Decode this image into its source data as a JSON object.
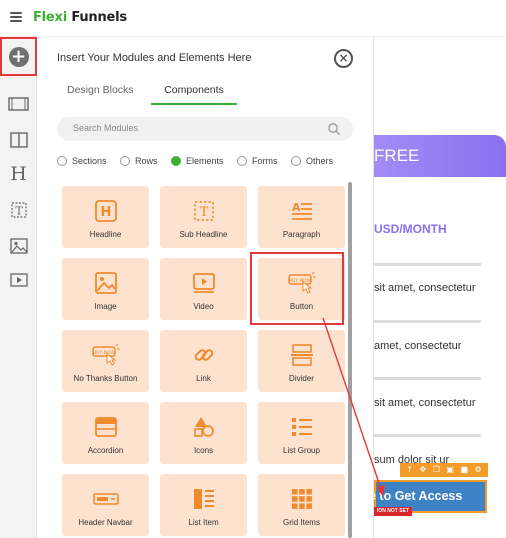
{
  "app": {
    "logo_part1": "Flexi",
    "logo_part2": "Funnels"
  },
  "rail": {
    "items": [
      {
        "name": "add-icon"
      },
      {
        "name": "section-icon"
      },
      {
        "name": "columns-icon"
      },
      {
        "name": "heading-icon",
        "glyph": "H"
      },
      {
        "name": "text-icon"
      },
      {
        "name": "image-icon"
      },
      {
        "name": "video-icon"
      }
    ]
  },
  "panel": {
    "title": "Insert Your Modules and Elements Here",
    "tabs": [
      {
        "label": "Design Blocks",
        "active": false
      },
      {
        "label": "Components",
        "active": true
      }
    ],
    "search_placeholder": "Search Modules",
    "filters": [
      {
        "label": "Sections",
        "selected": false
      },
      {
        "label": "Rows",
        "selected": false
      },
      {
        "label": "Elements",
        "selected": true
      },
      {
        "label": "Forms",
        "selected": false
      },
      {
        "label": "Others",
        "selected": false
      }
    ],
    "tiles": [
      {
        "label": "Headline",
        "icon": "headline-icon"
      },
      {
        "label": "Sub Headline",
        "icon": "sub-headline-icon"
      },
      {
        "label": "Paragraph",
        "icon": "paragraph-icon"
      },
      {
        "label": "Image",
        "icon": "image-icon"
      },
      {
        "label": "Video",
        "icon": "video-icon"
      },
      {
        "label": "Button",
        "icon": "button-icon"
      },
      {
        "label": "No Thanks Button",
        "icon": "no-thanks-button-icon"
      },
      {
        "label": "Link",
        "icon": "link-icon"
      },
      {
        "label": "Divider",
        "icon": "divider-icon"
      },
      {
        "label": "Accordion",
        "icon": "accordion-icon"
      },
      {
        "label": "Icons",
        "icon": "icons-icon"
      },
      {
        "label": "List Group",
        "icon": "list-group-icon"
      },
      {
        "label": "Header Navbar",
        "icon": "header-navbar-icon"
      },
      {
        "label": "List Item",
        "icon": "list-item-icon"
      },
      {
        "label": "Grid Items",
        "icon": "grid-items-icon"
      }
    ],
    "button_icon_text": "BUY NOW"
  },
  "canvas": {
    "banner_text": "FREE",
    "price_text": "USD/MONTH",
    "features": [
      "sit amet, consectetur",
      "amet, consectetur",
      "sit amet, consectetur",
      "sum dolor sit ur"
    ],
    "cta_label": "e to Get Access",
    "cta_warning": "ION NOT SET"
  },
  "colors": {
    "brand_green": "#3cb034",
    "tile_bg": "#fde3cf",
    "icon_orange": "#f08a2c",
    "accent_purple": "#8a6ff0",
    "cta_blue": "#3d82c4",
    "annotation_red": "#e23a3a"
  }
}
